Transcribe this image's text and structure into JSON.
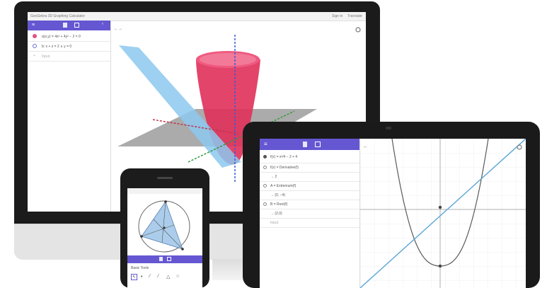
{
  "desktop": {
    "window_title": "GeoGebra 3D Graphing Calculator",
    "title_right_1": "Sign in",
    "title_right_2": "Translate",
    "algebra": [
      {
        "text": "a(x,y) = 4x² + 4y² − 2 = 0",
        "color": "#e05282"
      },
      {
        "text": "b: x + z = 2 ∧ y = 0",
        "color": "#4a90e2"
      }
    ],
    "input_placeholder": "Input"
  },
  "tablet": {
    "algebra": [
      {
        "label": "f(x) = x²/4 − 2 + 4"
      },
      {
        "label": "f(x) = Derivative(f)"
      },
      {
        "label": "→ 2"
      },
      {
        "label": "A = Extremum(f)"
      },
      {
        "label": "→ (0, −4)"
      },
      {
        "label": "B = Root(f)"
      },
      {
        "label": "→ (2,0)"
      },
      {
        "label": "Input"
      }
    ]
  },
  "phone": {
    "tool_section_label": "Basic Tools"
  },
  "colors": {
    "accent": "#6557d2",
    "surface_red": "#e0305a",
    "plane_blue": "#8cc8ef",
    "parabola": "#555555",
    "line": "#5aa6d6"
  }
}
